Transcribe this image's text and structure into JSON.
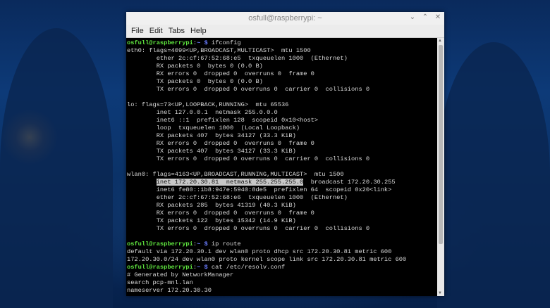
{
  "window": {
    "title": "osfull@raspberrypi: ~"
  },
  "menu": [
    "File",
    "Edit",
    "Tabs",
    "Help"
  ],
  "prompt": {
    "user": "osfull@raspberrypi",
    "sep": ":",
    "dir": "~",
    "sym": " $ "
  },
  "terminal_lines": [
    {
      "cmd": "ifconfig"
    },
    {
      "text": "eth0: flags=4099<UP,BROADCAST,MULTICAST>  mtu 1500"
    },
    {
      "text": "        ether 2c:cf:67:52:68:e5  txqueuelen 1000  (Ethernet)"
    },
    {
      "text": "        RX packets 0  bytes 0 (0.0 B)"
    },
    {
      "text": "        RX errors 0  dropped 0  overruns 0  frame 0"
    },
    {
      "text": "        TX packets 0  bytes 0 (0.0 B)"
    },
    {
      "text": "        TX errors 0  dropped 0 overruns 0  carrier 0  collisions 0"
    },
    {
      "text": ""
    },
    {
      "text": "lo: flags=73<UP,LOOPBACK,RUNNING>  mtu 65536"
    },
    {
      "text": "        inet 127.0.0.1  netmask 255.0.0.0"
    },
    {
      "text": "        inet6 ::1  prefixlen 128  scopeid 0x10<host>"
    },
    {
      "text": "        loop  txqueuelen 1000  (Local Loopback)"
    },
    {
      "text": "        RX packets 407  bytes 34127 (33.3 KiB)"
    },
    {
      "text": "        RX errors 0  dropped 0  overruns 0  frame 0"
    },
    {
      "text": "        TX packets 407  bytes 34127 (33.3 KiB)"
    },
    {
      "text": "        TX errors 0  dropped 0 overruns 0  carrier 0  collisions 0"
    },
    {
      "text": ""
    },
    {
      "text": "wlan0: flags=4163<UP,BROADCAST,RUNNING,MULTICAST>  mtu 1500"
    },
    {
      "pre": "        ",
      "highlight": "inet 172.20.30.81  netmask 255.255.255.0",
      "post": "  broadcast 172.20.30.255"
    },
    {
      "text": "        inet6 fe80::1b8:947e:5940:8de5  prefixlen 64  scopeid 0x20<link>"
    },
    {
      "text": "        ether 2c:cf:67:52:68:e6  txqueuelen 1000  (Ethernet)"
    },
    {
      "text": "        RX packets 285  bytes 41319 (40.3 KiB)"
    },
    {
      "text": "        RX errors 0  dropped 0  overruns 0  frame 0"
    },
    {
      "text": "        TX packets 122  bytes 15342 (14.9 KiB)"
    },
    {
      "text": "        TX errors 0  dropped 0 overruns 0  carrier 0  collisions 0"
    },
    {
      "text": ""
    },
    {
      "cmd": "ip route"
    },
    {
      "text": "default via 172.20.30.1 dev wlan0 proto dhcp src 172.20.30.81 metric 600"
    },
    {
      "text": "172.20.30.0/24 dev wlan0 proto kernel scope link src 172.20.30.81 metric 600"
    },
    {
      "cmd": "cat /etc/resolv.conf"
    },
    {
      "text": "# Generated by NetworkManager"
    },
    {
      "text": "search pcp-mnl.lan"
    },
    {
      "text": "nameserver 172.20.30.30"
    }
  ]
}
